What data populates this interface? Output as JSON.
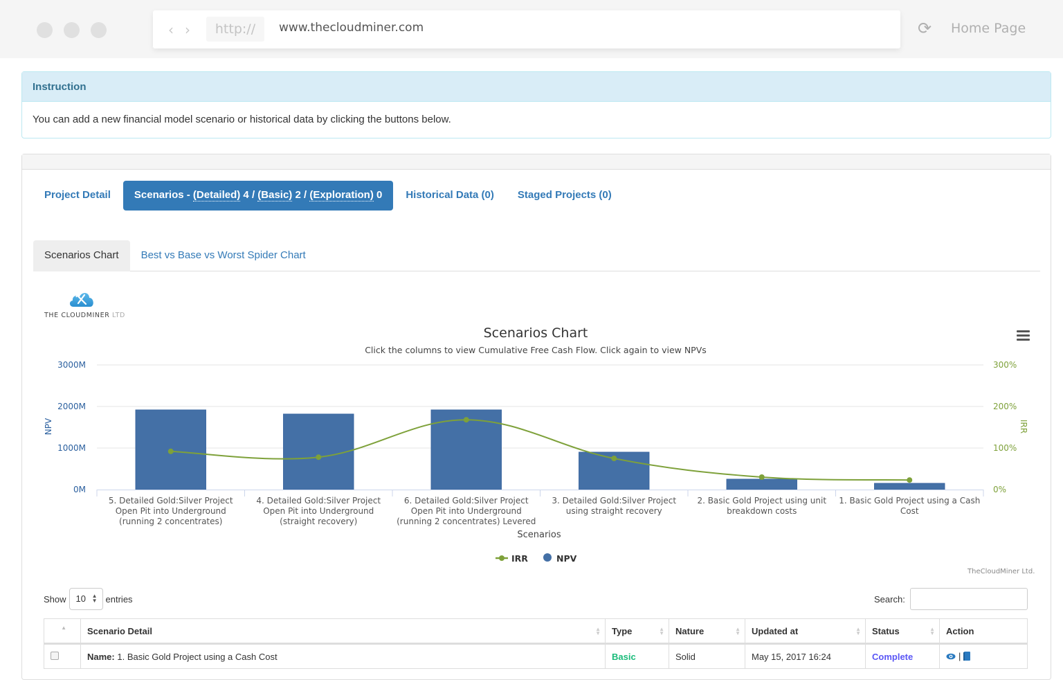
{
  "browser": {
    "protocol": "http://",
    "url": "www.thecloudminer.com",
    "home_label": "Home Page",
    "back_icon": "‹",
    "forward_icon": "›",
    "reload_icon": "⟳"
  },
  "instruction": {
    "title": "Instruction",
    "body": "You can add a new financial model scenario or historical data by clicking the buttons below."
  },
  "nav_pills": {
    "project_detail": "Project Detail",
    "scenarios_prefix": "Scenarios - ",
    "detailed_label": "(Detailed)",
    "detailed_count": " 4 / ",
    "basic_label": "(Basic)",
    "basic_count": " 2 / ",
    "exploration_label": "(Exploration)",
    "exploration_count": " 0",
    "historical": "Historical Data (0)",
    "staged": "Staged Projects (0)"
  },
  "chart_tabs": {
    "scenarios_chart": "Scenarios Chart",
    "spider_chart": "Best vs Base vs Worst Spider Chart"
  },
  "logo": {
    "name": "THE CLOUDMINER",
    "suffix": " LTD"
  },
  "chart_data": {
    "type": "bar",
    "title": "Scenarios Chart",
    "subtitle": "Click the columns to view Cumulative Free Cash Flow. Click again to view NPVs",
    "xlabel": "Scenarios",
    "ylabel": "NPV",
    "y2label": "IRR",
    "ylim": [
      0,
      3000
    ],
    "y2lim": [
      0,
      300
    ],
    "yticks": [
      "0M",
      "1000M",
      "2000M",
      "3000M"
    ],
    "y2ticks": [
      "0%",
      "100%",
      "200%",
      "300%"
    ],
    "grid": true,
    "legend_position": "bottom-center",
    "categories": [
      [
        "5. Detailed Gold:Silver Project",
        "Open Pit into Underground",
        "(running 2 concentrates)"
      ],
      [
        "4. Detailed Gold:Silver Project",
        "Open Pit into Underground",
        "(straight recovery)"
      ],
      [
        "6. Detailed Gold:Silver Project",
        "Open Pit into Underground",
        "(running 2 concentrates) Levered"
      ],
      [
        "3. Detailed Gold:Silver Project",
        "using straight recovery"
      ],
      [
        "2. Basic Gold Project using unit",
        "breakdown costs"
      ],
      [
        "1. Basic Gold Project using a Cash",
        "Cost"
      ]
    ],
    "series": [
      {
        "name": "IRR",
        "type": "spline",
        "axis": "right",
        "color": "#7ea13a",
        "values": [
          92,
          78,
          168,
          75,
          30,
          23
        ]
      },
      {
        "name": "NPV",
        "type": "column",
        "axis": "left",
        "color": "#4470a6",
        "values": [
          1917,
          1817,
          1917,
          900,
          250,
          150
        ]
      }
    ],
    "credits": "TheCloudMiner Ltd."
  },
  "table_controls": {
    "show_label": "Show",
    "entries_value": "10",
    "entries_label": "entries",
    "search_label": "Search:",
    "search_value": ""
  },
  "table": {
    "headers": [
      "",
      "Scenario Detail",
      "Type",
      "Nature",
      "Updated at",
      "Status",
      "Action"
    ],
    "rows": [
      {
        "name_label": "Name:",
        "name_value": " 1. Basic Gold Project using a Cash Cost",
        "type": "Basic",
        "nature": "Solid",
        "updated_at": "May 15, 2017 16:24",
        "status": "Complete",
        "action_sep": "|"
      }
    ]
  }
}
